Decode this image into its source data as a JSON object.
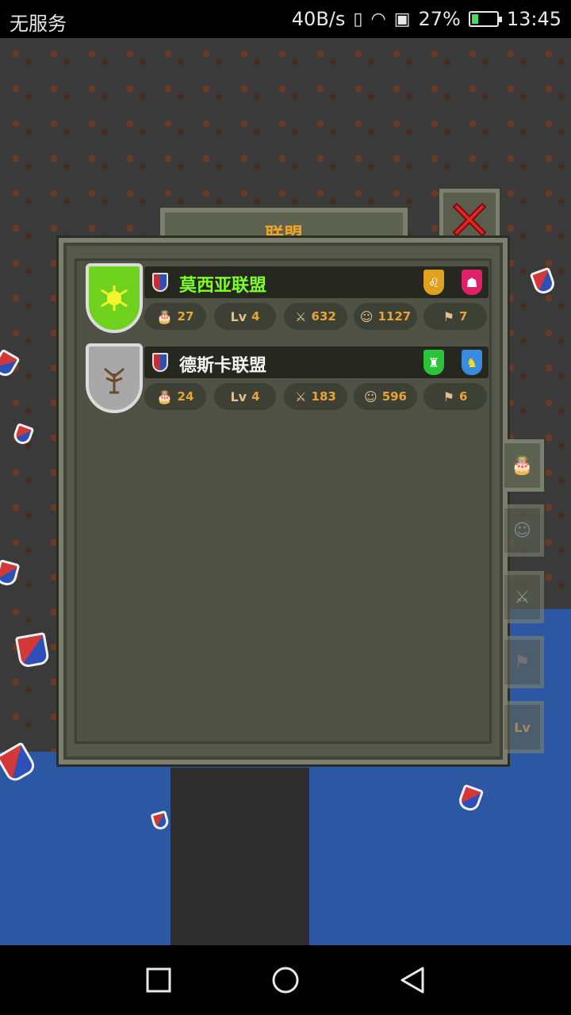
{
  "status_bar": {
    "carrier": "无服务",
    "speed": "40B/s",
    "battery": "27%",
    "battery_level": 0.27,
    "time": "13:45"
  },
  "panel": {
    "title": "联盟"
  },
  "alliances": [
    {
      "name": "莫西亚联盟",
      "name_color": "#7dff2a",
      "shield_color": "#6ed21e",
      "stats": {
        "cake": "27",
        "level": "4",
        "attack": "632",
        "members": "1127",
        "territories": "7"
      }
    },
    {
      "name": "德斯卡联盟",
      "name_color": "#f2f2f2",
      "shield_color": "#a8a8a8",
      "stats": {
        "cake": "24",
        "level": "4",
        "attack": "183",
        "members": "596",
        "territories": "6"
      }
    }
  ],
  "labels": {
    "level_prefix": "Lv"
  },
  "side_tabs": [
    {
      "icon": "cake-add-icon"
    },
    {
      "icon": "members-icon"
    },
    {
      "icon": "sword-icon"
    },
    {
      "icon": "territory-icon"
    },
    {
      "icon": "level-icon",
      "label": "Lv"
    }
  ],
  "colors": {
    "accent": "#f0a22b",
    "panel": "#55584a",
    "water": "#2c57a3"
  }
}
